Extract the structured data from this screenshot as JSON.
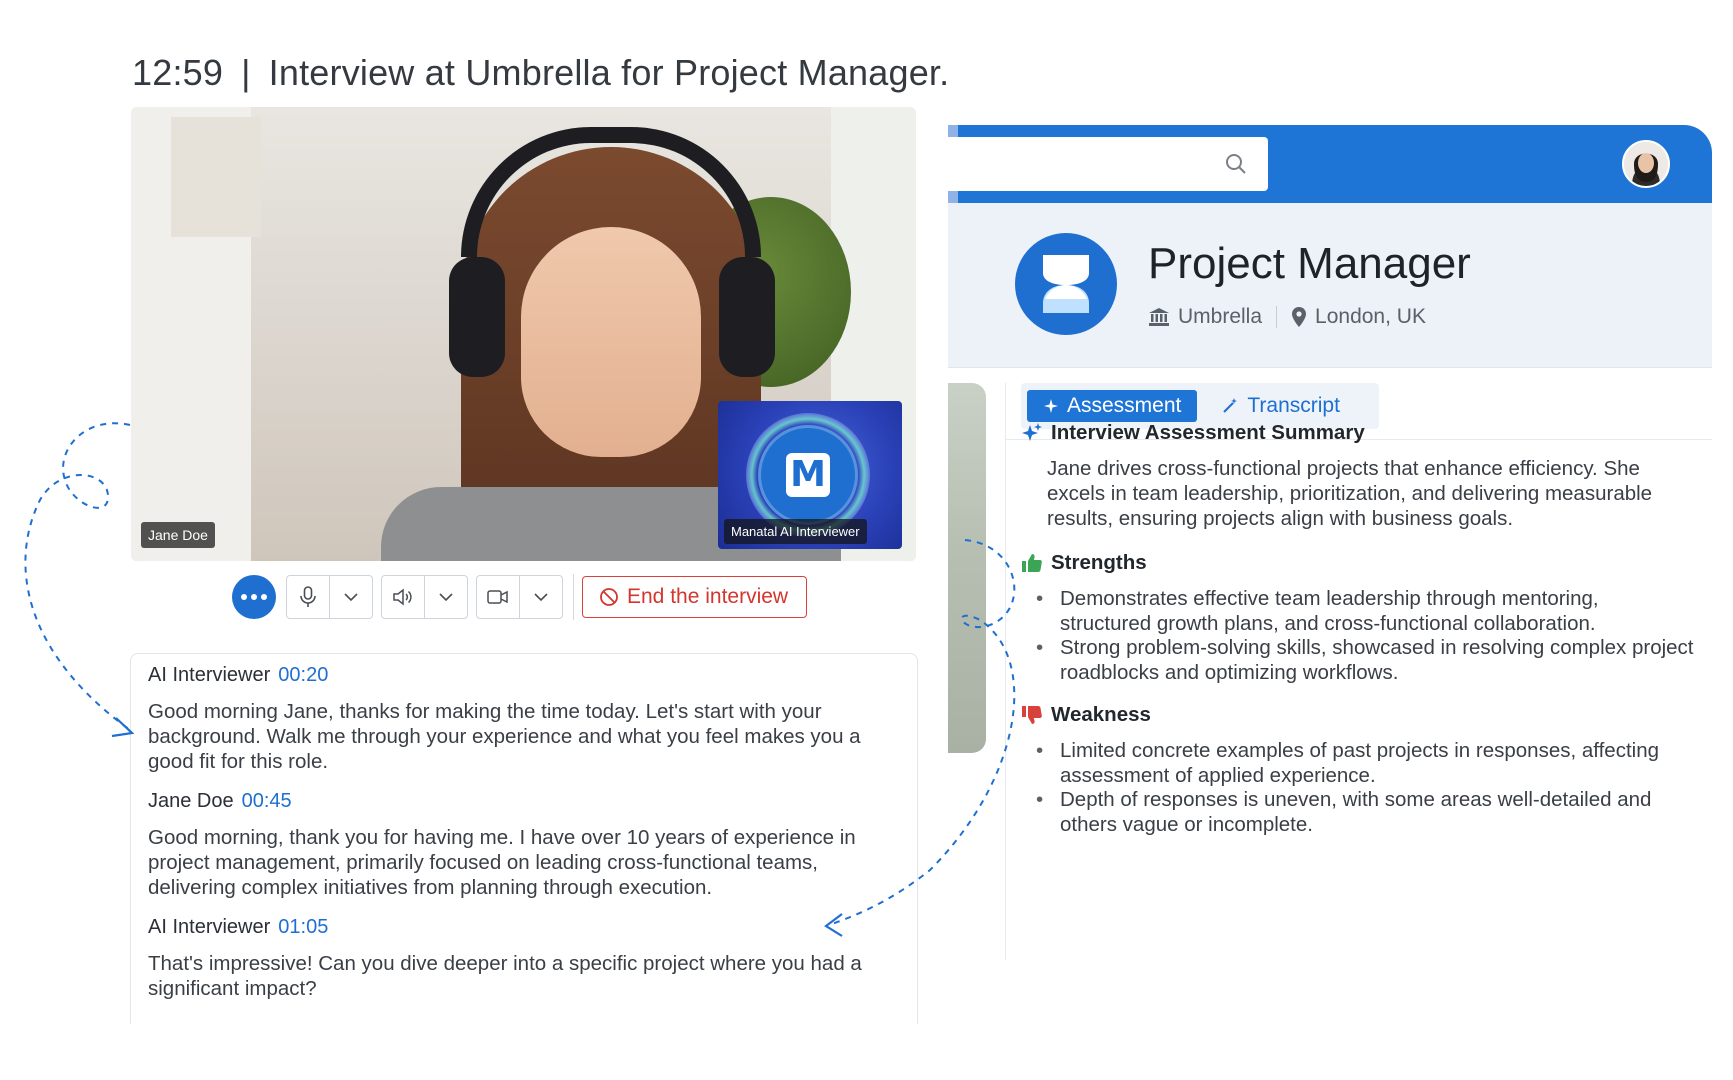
{
  "header": {
    "time": "12:59",
    "separator": "|",
    "title": "Interview at Umbrella for Project Manager."
  },
  "video": {
    "candidate_name": "Jane Doe",
    "ai_label": "Manatal AI Interviewer",
    "ai_logo_letter": "M"
  },
  "controls": {
    "more_icon": "more-dots-icon",
    "mic_icon": "microphone-icon",
    "speaker_icon": "speaker-icon",
    "camera_icon": "camera-icon",
    "end_label": "End the interview"
  },
  "transcript": [
    {
      "speaker": "AI Interviewer",
      "time": "00:20",
      "text": "Good morning Jane, thanks for making the time today. Let's start with your background. Walk me through your experience and what you feel makes you a good fit for this role."
    },
    {
      "speaker": "Jane Doe",
      "time": "00:45",
      "text": "Good morning, thank you for having me. I have over 10 years of experience in project management, primarily focused on leading cross-functional teams, delivering complex initiatives from planning through execution."
    },
    {
      "speaker": "AI Interviewer",
      "time": "01:05",
      "text": "That's impressive! Can you dive deeper into a specific project where you had a significant impact?"
    }
  ],
  "job": {
    "title": "Project Manager",
    "company": "Umbrella",
    "location": "London, UK"
  },
  "tabs": {
    "assessment": "Assessment",
    "transcript": "Transcript"
  },
  "assessment": {
    "summary_heading": "Interview Assessment Summary",
    "summary_text": "Jane drives cross-functional projects that enhance efficiency. She excels in team leadership, prioritization, and delivering measurable results, ensuring projects align with business goals.",
    "strengths_heading": "Strengths",
    "strengths": [
      "Demonstrates effective team leadership through mentoring, structured growth plans, and cross-functional collaboration.",
      "Strong problem-solving skills, showcased in resolving complex project roadblocks and optimizing workflows."
    ],
    "weakness_heading": "Weakness",
    "weaknesses": [
      "Limited concrete examples of past projects in responses, affecting assessment of applied experience.",
      "Depth of responses is uneven, with some areas well-detailed and others vague or incomplete."
    ]
  },
  "colors": {
    "brand_blue": "#1f75d6",
    "time_blue": "#1f6fd1",
    "danger_red": "#d3362e",
    "strength_green": "#3aa655",
    "weakness_red": "#d9423a"
  }
}
